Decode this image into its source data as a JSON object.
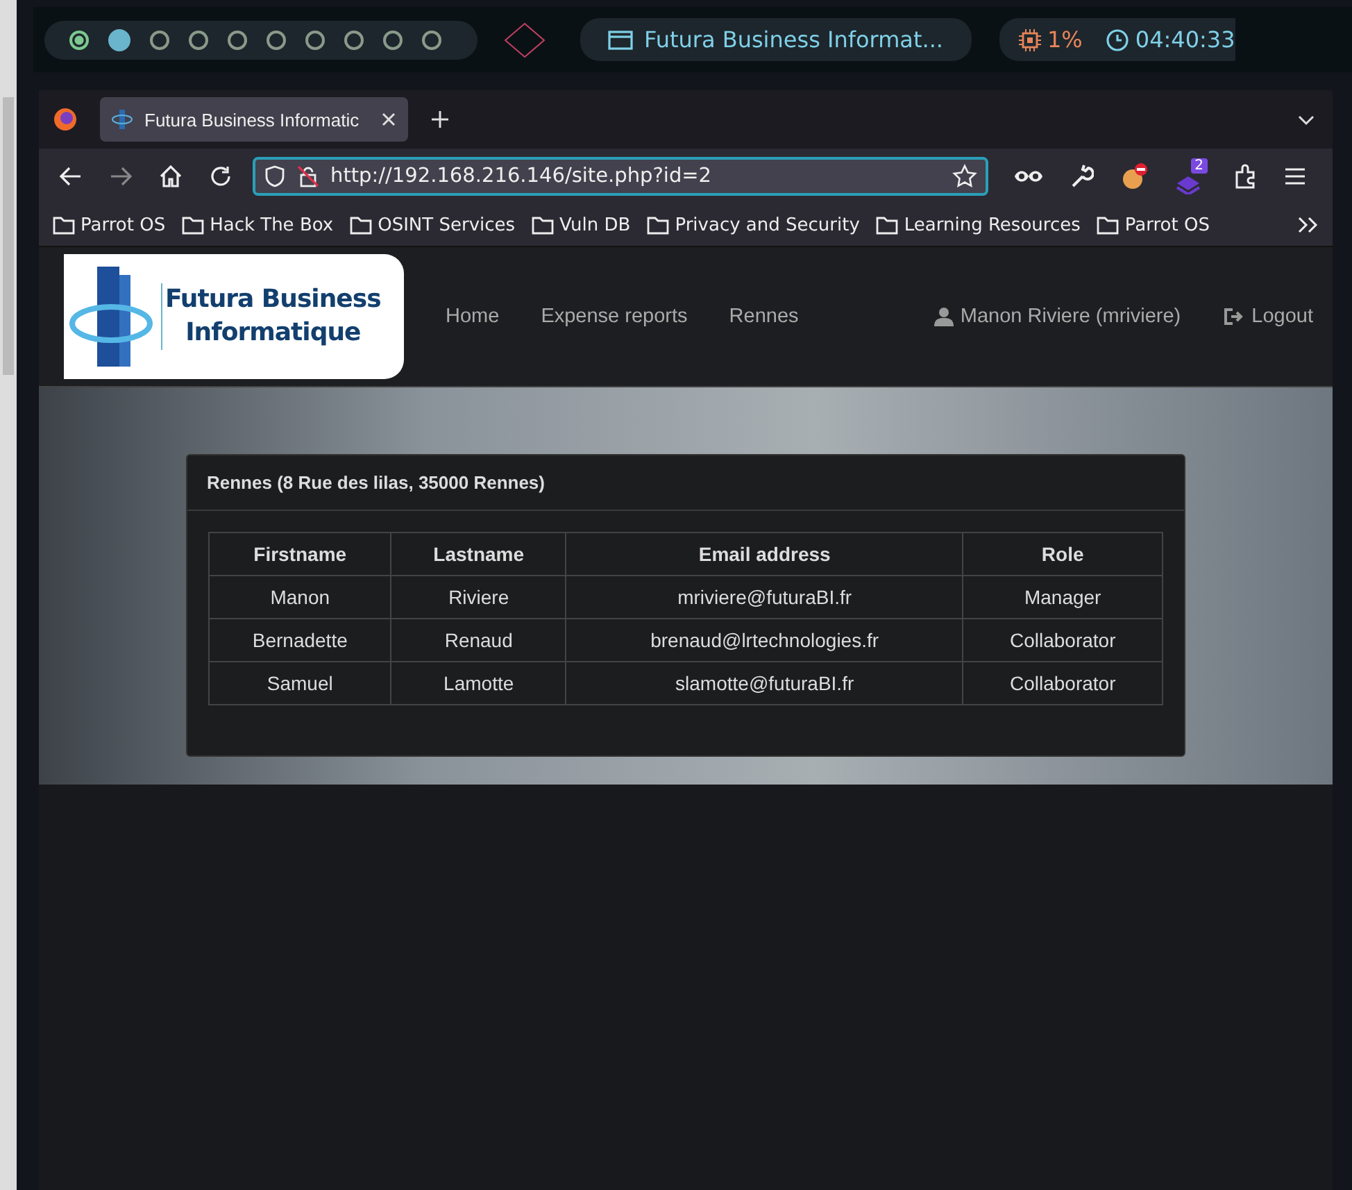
{
  "top_panel": {
    "workspaces": [
      {
        "kind": "current"
      },
      {
        "kind": "occupied"
      },
      {
        "kind": "empty"
      },
      {
        "kind": "empty"
      },
      {
        "kind": "empty"
      },
      {
        "kind": "empty"
      },
      {
        "kind": "empty"
      },
      {
        "kind": "empty"
      },
      {
        "kind": "empty"
      },
      {
        "kind": "empty"
      }
    ],
    "window_title": "Futura Business Informat...",
    "cpu": "1%",
    "clock": "04:40:33"
  },
  "browser": {
    "tab": {
      "title": "Futura Business Informatic"
    },
    "url": "http://192.168.216.146/site.php?id=2",
    "extension_badge": "2",
    "bookmarks": [
      "Parrot OS",
      "Hack The Box",
      "OSINT Services",
      "Vuln DB",
      "Privacy and Security",
      "Learning Resources",
      "Parrot OS"
    ]
  },
  "site": {
    "logo": {
      "line_1": "Futura Business",
      "line_2": "Informatique"
    },
    "nav": [
      "Home",
      "Expense reports",
      "Rennes"
    ],
    "user": "Manon Riviere (mriviere)",
    "logout": "Logout",
    "panel": {
      "title": "Rennes (8 Rue des lilas, 35000 Rennes)",
      "table": {
        "columns": [
          "Firstname",
          "Lastname",
          "Email address",
          "Role"
        ],
        "rows": [
          [
            "Manon",
            "Riviere",
            "mriviere@futuraBI.fr",
            "Manager"
          ],
          [
            "Bernadette",
            "Renaud",
            "brenaud@lrtechnologies.fr",
            "Collaborator"
          ],
          [
            "Samuel",
            "Lamotte",
            "slamotte@futuraBI.fr",
            "Collaborator"
          ]
        ]
      }
    }
  }
}
